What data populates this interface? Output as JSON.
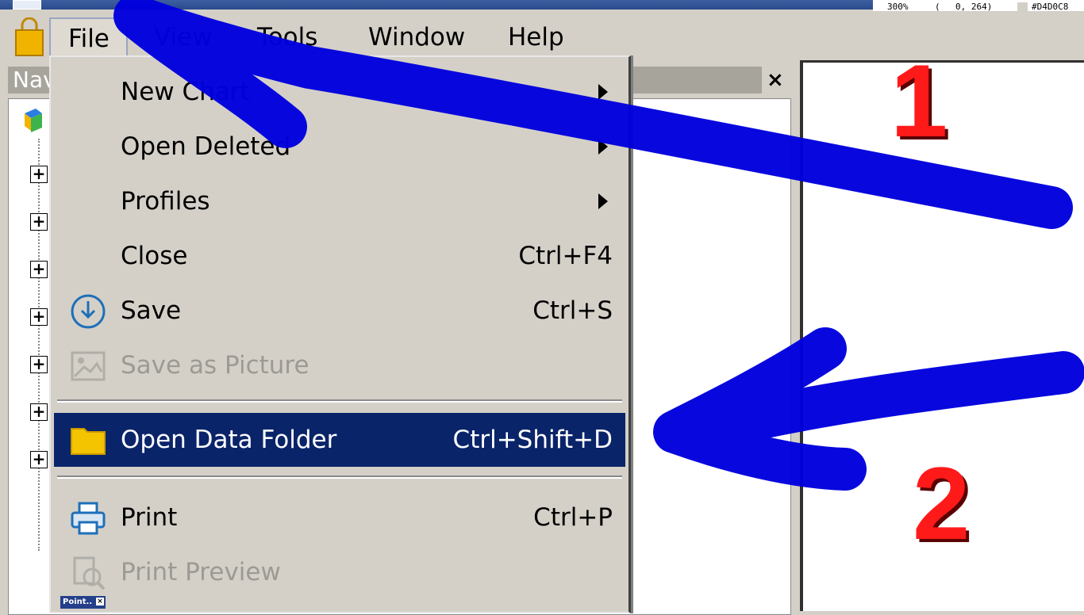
{
  "magnifier": {
    "zoom": "300%",
    "coords_open": "(",
    "coords": "0,  264)",
    "color_hex": "#D4D0C8"
  },
  "menubar": {
    "items": [
      "File",
      "View",
      "Tools",
      "Window",
      "Help"
    ]
  },
  "navigator": {
    "title": "Nav",
    "close_symbol": "×"
  },
  "file_menu": {
    "new_chart": "New Chart",
    "open_deleted": "Open Deleted",
    "profiles": "Profiles",
    "close": {
      "label": "Close",
      "shortcut": "Ctrl+F4"
    },
    "save": {
      "label": "Save",
      "shortcut": "Ctrl+S"
    },
    "save_as_picture": "Save as Picture",
    "open_data_folder": {
      "label": "Open Data Folder",
      "shortcut": "Ctrl+Shift+D"
    },
    "print": {
      "label": "Print",
      "shortcut": "Ctrl+P"
    },
    "print_preview": "Print Preview"
  },
  "taskbar_chip": {
    "label": "Point..",
    "close": "×"
  },
  "annotations": {
    "first": "1",
    "second": "2"
  },
  "colors": {
    "selection": "#0a246a",
    "arrow": "#0000dd",
    "annotation_number": "#ff1a1a",
    "menu_bg": "#d4d0c8"
  }
}
